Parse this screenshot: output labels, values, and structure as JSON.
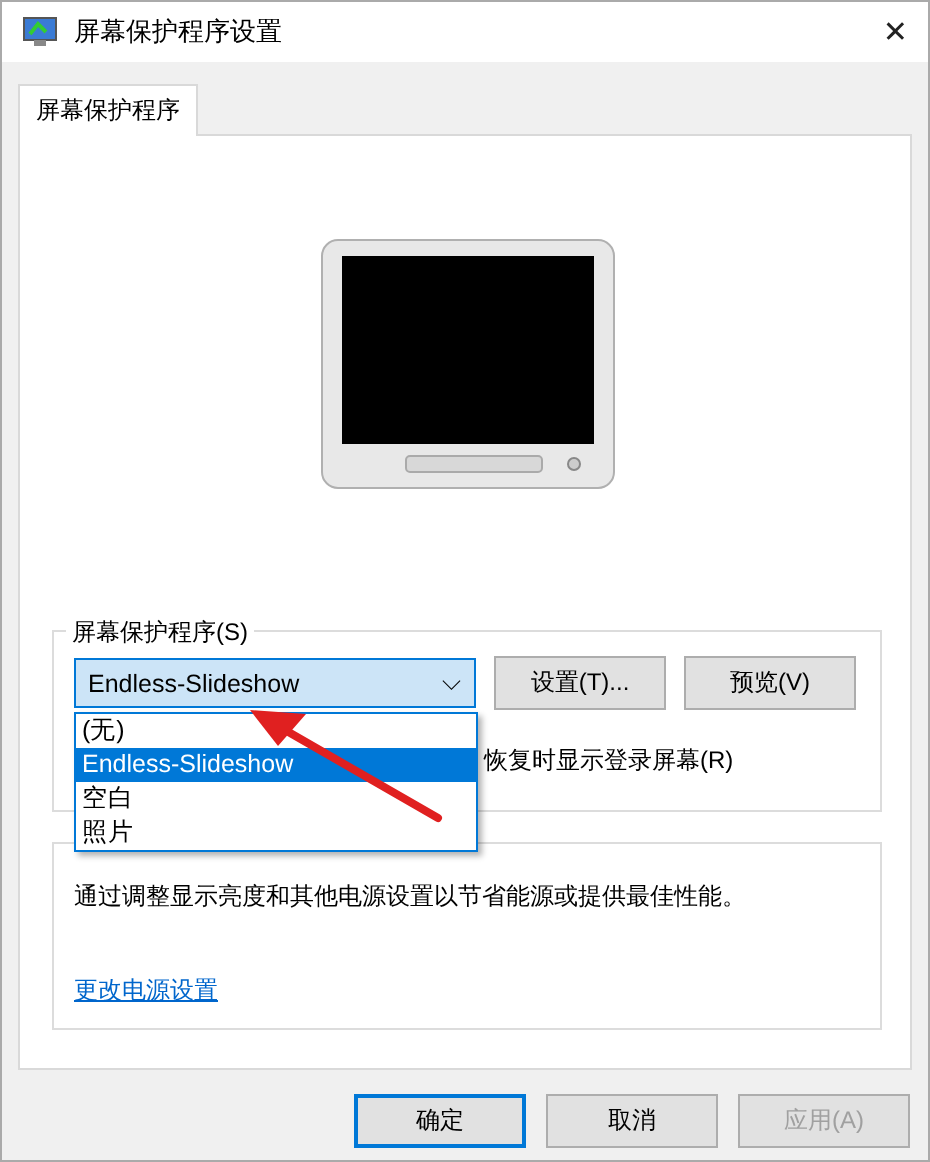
{
  "window": {
    "title": "屏幕保护程序设置",
    "close": "✕"
  },
  "tabs": [
    {
      "label": "屏幕保护程序",
      "selected": true
    }
  ],
  "screensaver_group": {
    "title": "屏幕保护程序(S)",
    "combo_value": "Endless-Slideshow",
    "combo_caret": "⌵",
    "options": [
      {
        "label": "(无)",
        "selected": false
      },
      {
        "label": "Endless-Slideshow",
        "selected": true
      },
      {
        "label": "空白",
        "selected": false
      },
      {
        "label": "照片",
        "selected": false
      }
    ],
    "buttons": [
      {
        "label": "设置(T)..."
      },
      {
        "label": "预览(V)"
      }
    ],
    "resume_text": "恢复时显示登录屏幕(R)"
  },
  "power_group": {
    "description": "通过调整显示亮度和其他电源设置以节省能源或提供最佳性能。",
    "link": "更改电源设置"
  },
  "footer_buttons": [
    {
      "label": "确定",
      "kind": "default",
      "disabled": false
    },
    {
      "label": "取消",
      "kind": "normal",
      "disabled": false
    },
    {
      "label": "应用(A)",
      "kind": "normal",
      "disabled": true
    }
  ]
}
